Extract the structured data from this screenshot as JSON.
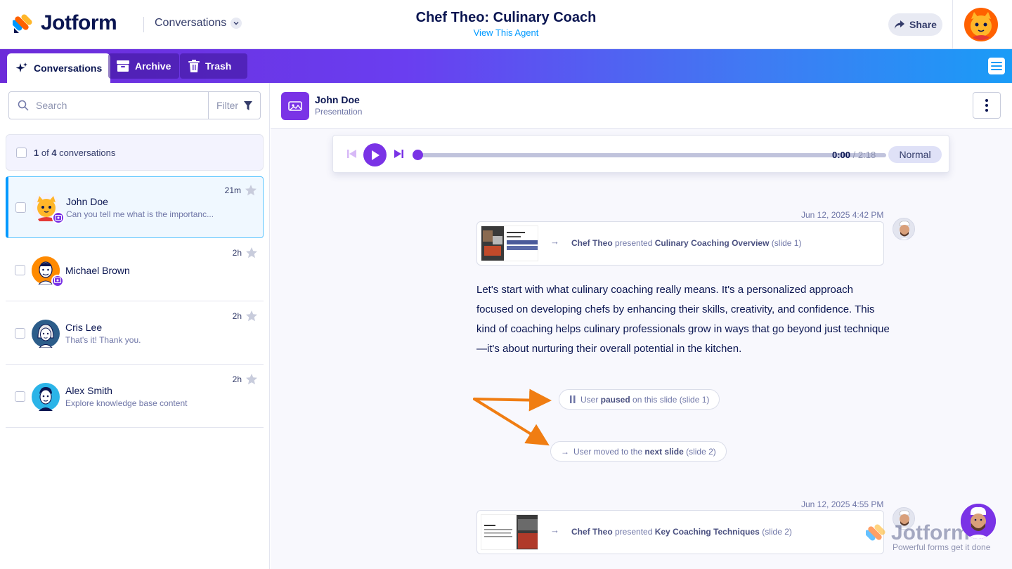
{
  "app": {
    "brand": "Jotform",
    "section_label": "Conversations",
    "agent_title": "Chef Theo: Culinary Coach",
    "agent_link": "View This Agent",
    "share_label": "Share"
  },
  "tabs": [
    {
      "label": "Conversations",
      "icon": "sparkle-icon",
      "active": true
    },
    {
      "label": "Archive",
      "icon": "archive-icon",
      "active": false
    },
    {
      "label": "Trash",
      "icon": "trash-icon",
      "active": false
    }
  ],
  "sidebar": {
    "search_placeholder": "Search",
    "filter_label": "Filter",
    "count_current": "1",
    "count_of": " of ",
    "count_total": "4",
    "count_suffix": " conversations",
    "items": [
      {
        "name": "John Doe",
        "preview": "Can you tell me what is the importanc...",
        "time": "21m",
        "active": true
      },
      {
        "name": "Michael Brown",
        "preview": "",
        "time": "2h",
        "active": false
      },
      {
        "name": "Cris Lee",
        "preview": "That's it! Thank you.",
        "time": "2h",
        "active": false
      },
      {
        "name": "Alex Smith",
        "preview": "Explore knowledge base content",
        "time": "2h",
        "active": false
      }
    ]
  },
  "main": {
    "contact_name": "John Doe",
    "contact_sub": "Presentation",
    "player": {
      "current": "0:00",
      "separator": " / ",
      "total": "2:18",
      "speed": "Normal",
      "progress": 0
    },
    "messages": [
      {
        "timestamp": "Jun 12, 2025 4:42 PM",
        "actor": "Chef Theo",
        "verb": " presented ",
        "title": "Culinary Coaching Overview",
        "slide": " (slide 1)"
      },
      {
        "text": "Let's start with what culinary coaching really means. It's a personalized approach focused on developing chefs by enhancing their skills, creativity, and confidence. This kind of coaching helps culinary professionals grow in ways that go beyond just technique—it's about nurturing their overall potential in the kitchen."
      },
      {
        "timestamp": "Jun 12, 2025 4:55 PM",
        "actor": "Chef Theo",
        "verb": " presented ",
        "title": "Key Coaching Techniques",
        "slide": " (slide 2)"
      }
    ],
    "events": [
      {
        "pre": "User ",
        "bold": "paused",
        "post": " on this slide",
        "slide": " (slide 1)",
        "icon": "pause-icon"
      },
      {
        "pre": "User moved to the ",
        "bold": "next slide",
        "post": "",
        "slide": " (slide 2)",
        "icon": "arrow-right-icon"
      }
    ]
  },
  "watermark": {
    "brand": "Jotform",
    "tagline": "Powerful forms get it done"
  },
  "colors": {
    "accent": "#7a33e6",
    "link": "#0099ff",
    "annotation_arrow": "#f07d12"
  }
}
